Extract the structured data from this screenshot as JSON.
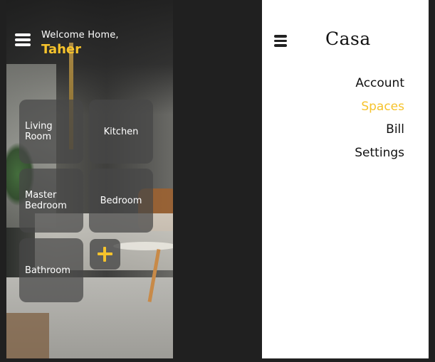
{
  "home": {
    "welcome_text": "Welcome Home,",
    "user_name": "Taher",
    "rooms": [
      {
        "label": "Living\nRoom"
      },
      {
        "label": "Kitchen"
      },
      {
        "label": "Master\nBedroom"
      },
      {
        "label": "Bedroom"
      },
      {
        "label": "Bathroom"
      }
    ],
    "icons": {
      "menu": "hamburger-menu-icon",
      "add_room": "plus-icon"
    }
  },
  "menu": {
    "brand": "Casa",
    "items": [
      {
        "label": "Account",
        "active": false
      },
      {
        "label": "Spaces",
        "active": true
      },
      {
        "label": "Bill",
        "active": false
      },
      {
        "label": "Settings",
        "active": false
      }
    ],
    "icons": {
      "menu": "hamburger-menu-icon"
    }
  },
  "colors": {
    "accent": "#f6c32c",
    "background": "#202020",
    "tile": "#464646",
    "text_dark": "#111111",
    "text_light": "#ffffff"
  }
}
